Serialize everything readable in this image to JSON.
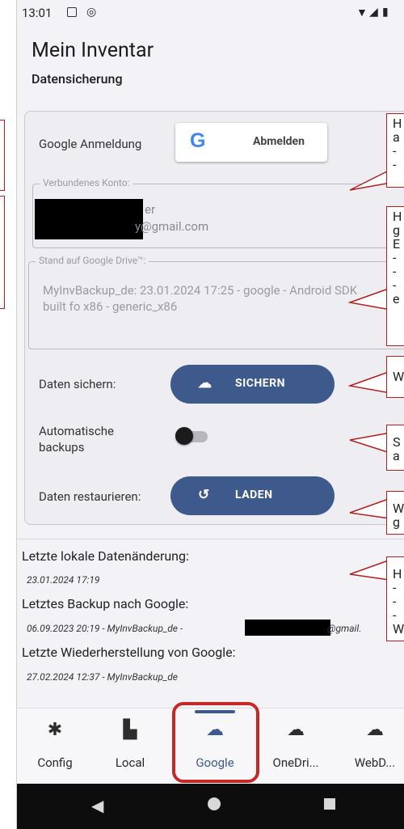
{
  "status": {
    "time": "13:01",
    "icons": [
      "image-icon",
      "at-icon",
      "wifi-icon",
      "signal-icon",
      "battery-icon"
    ]
  },
  "app": {
    "title": "Mein Inventar",
    "subtitle": "Datensicherung"
  },
  "google_login": {
    "label": "Google Anmeldung",
    "button": "Abmelden",
    "g_letter": "G"
  },
  "account": {
    "legend": "Verbundenes Konto:",
    "name_suffix": "er",
    "email_suffix": "y@gmail.com"
  },
  "drive": {
    "legend": "Stand auf Google Drive™:",
    "text": "MyInvBackup_de: 23.01.2024 17:25 - google - Android SDK built fo x86 - generic_x86"
  },
  "backup": {
    "label": "Daten sichern:",
    "button": "SICHERN"
  },
  "auto": {
    "label": "Automatische backups",
    "on": false
  },
  "restore": {
    "label": "Daten restaurieren:",
    "button": "LADEN"
  },
  "info": {
    "local_h": "Letzte lokale Datenänderung:",
    "local_v": "23.01.2024 17:19",
    "backup_h": "Letztes Backup nach Google:",
    "backup_v": "06.09.2023 20:19 - MyInvBackup_de -",
    "backup_v_end": "@gmail.",
    "restore_h": "Letzte Wiederherstellung von Google:",
    "restore_v": "27.02.2024 12:37 - MyInvBackup_de"
  },
  "nav": [
    {
      "label": "Config",
      "icon": "gear-icon",
      "active": false
    },
    {
      "label": "Local",
      "icon": "file-icon",
      "active": false
    },
    {
      "label": "Google",
      "icon": "cloud-upload-icon",
      "active": true
    },
    {
      "label": "OneDri...",
      "icon": "cloud-icon",
      "active": false
    },
    {
      "label": "WebD...",
      "icon": "cloud-outline-icon",
      "active": false
    }
  ],
  "callouts": [
    "H\na\n-\n-",
    "H\ng\nE\n-\n-\n-\ne",
    "W",
    "S\na",
    "W\ng",
    "H\n-\n-\n-\nW"
  ],
  "colors": {
    "accent": "#3e5a8c",
    "annotation": "#b02020",
    "background": "#f3f3f7"
  }
}
